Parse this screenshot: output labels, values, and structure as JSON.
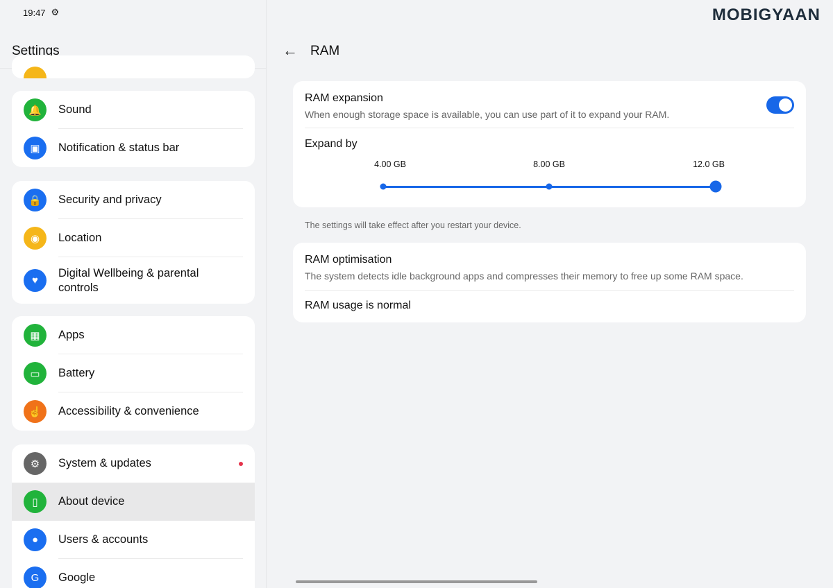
{
  "status": {
    "time": "19:47",
    "gear_icon": "gear-icon"
  },
  "watermark": "MOBIGYAAN",
  "left": {
    "title": "Settings",
    "groups": [
      [
        {
          "label": "Sound",
          "icon": "bell-icon",
          "color": "#21b33b"
        },
        {
          "label": "Notification & status bar",
          "icon": "notification-icon",
          "color": "#1a6ef0"
        }
      ],
      [
        {
          "label": "Security and privacy",
          "icon": "shield-icon",
          "color": "#1a6ef0"
        },
        {
          "label": "Location",
          "icon": "location-icon",
          "color": "#f5b619"
        },
        {
          "label": "Digital Wellbeing & parental controls",
          "icon": "heart-person-icon",
          "color": "#1a6ef0"
        }
      ],
      [
        {
          "label": "Apps",
          "icon": "apps-icon",
          "color": "#21b33b"
        },
        {
          "label": "Battery",
          "icon": "battery-icon",
          "color": "#21b33b"
        },
        {
          "label": "Accessibility & convenience",
          "icon": "hand-icon",
          "color": "#f07219"
        }
      ],
      [
        {
          "label": "System & updates",
          "icon": "gear-icon",
          "color": "#666666",
          "badge": true
        },
        {
          "label": "About device",
          "icon": "phone-icon",
          "color": "#21b33b",
          "selected": true
        },
        {
          "label": "Users & accounts",
          "icon": "user-icon",
          "color": "#1a6ef0"
        },
        {
          "label": "Google",
          "icon": "google-icon",
          "color": "#1a6ef0"
        }
      ]
    ]
  },
  "right": {
    "title": "RAM",
    "expansion": {
      "title": "RAM expansion",
      "desc": "When enough storage space is available, you can use part of it to expand your RAM.",
      "enabled": true,
      "expand_label": "Expand by",
      "options": [
        "4.00 GB",
        "8.00 GB",
        "12.0 GB"
      ],
      "selected_index": 2
    },
    "note": "The settings will take effect after you restart your device.",
    "optimisation": {
      "title": "RAM optimisation",
      "desc": "The system detects idle background apps and compresses their memory to free up some RAM space.",
      "status": "RAM usage is normal"
    }
  },
  "accent": "#1767e8"
}
